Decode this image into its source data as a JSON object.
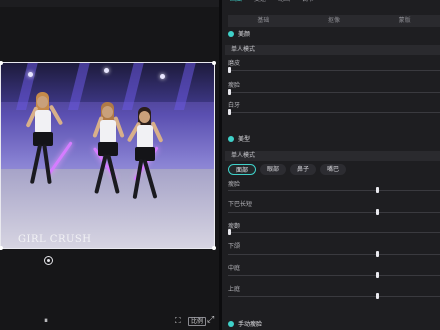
{
  "player": {
    "video_caption": "GIRL CRUSH",
    "controls": {
      "play_icon": "⏸",
      "crop_icon": "⛶",
      "ratio_label": "比例",
      "fullscreen_icon": "⤢"
    }
  },
  "inspector": {
    "top_tabs": [
      "画面",
      "变速",
      "动画",
      "调节",
      "AI"
    ],
    "sub_tabs": [
      "基础",
      "抠像",
      "蒙版"
    ],
    "section_beauty": {
      "header": "美颜",
      "mode": "单人模式",
      "params": [
        {
          "label": "磨皮",
          "value": 0
        },
        {
          "label": "瘦脸",
          "value": 0
        },
        {
          "label": "白牙",
          "value": 0
        }
      ]
    },
    "section_body": {
      "header": "美型",
      "mode": "单人模式",
      "pills": [
        "面部",
        "眼部",
        "鼻子",
        "嘴巴"
      ],
      "active_pill": 0,
      "params": [
        {
          "label": "瘦脸",
          "value": 0.7
        },
        {
          "label": "下巴长短",
          "value": 0.7
        },
        {
          "label": "瘦颧",
          "value": 0
        },
        {
          "label": "下颌",
          "value": 0.7
        },
        {
          "label": "中庭",
          "value": 0.7
        },
        {
          "label": "上庭",
          "value": 0.7
        }
      ]
    },
    "section_makeup": {
      "header": "手动瘦脸"
    }
  }
}
